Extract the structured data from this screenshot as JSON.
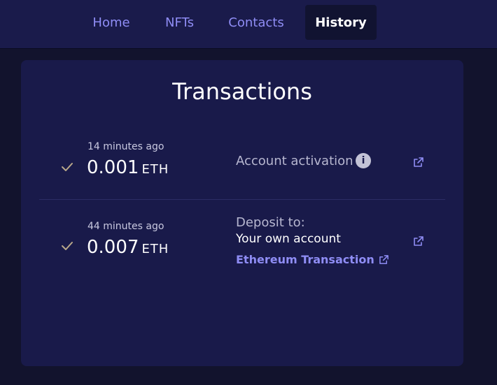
{
  "nav": {
    "tabs": [
      {
        "label": "Home"
      },
      {
        "label": "NFTs"
      },
      {
        "label": "Contacts"
      },
      {
        "label": "History"
      }
    ],
    "active": "History"
  },
  "page": {
    "title": "Transactions"
  },
  "transactions": [
    {
      "time": "14 minutes ago",
      "amount": "0.001",
      "unit": "ETH",
      "description": "Account activation",
      "status_icon": "check-icon",
      "info_icon": "info-icon",
      "external_icon": "external-link-icon"
    },
    {
      "time": "44 minutes ago",
      "amount": "0.007",
      "unit": "ETH",
      "description": "Deposit to:",
      "subtitle": "Your own account",
      "link_label": "Ethereum Transaction",
      "status_icon": "check-icon",
      "external_icon": "external-link-icon"
    }
  ],
  "colors": {
    "background": "#12132d",
    "nav_background": "#1a1b4b",
    "card_background": "#191a4a",
    "accent": "#8f8df5",
    "check": "#b9a88a"
  }
}
